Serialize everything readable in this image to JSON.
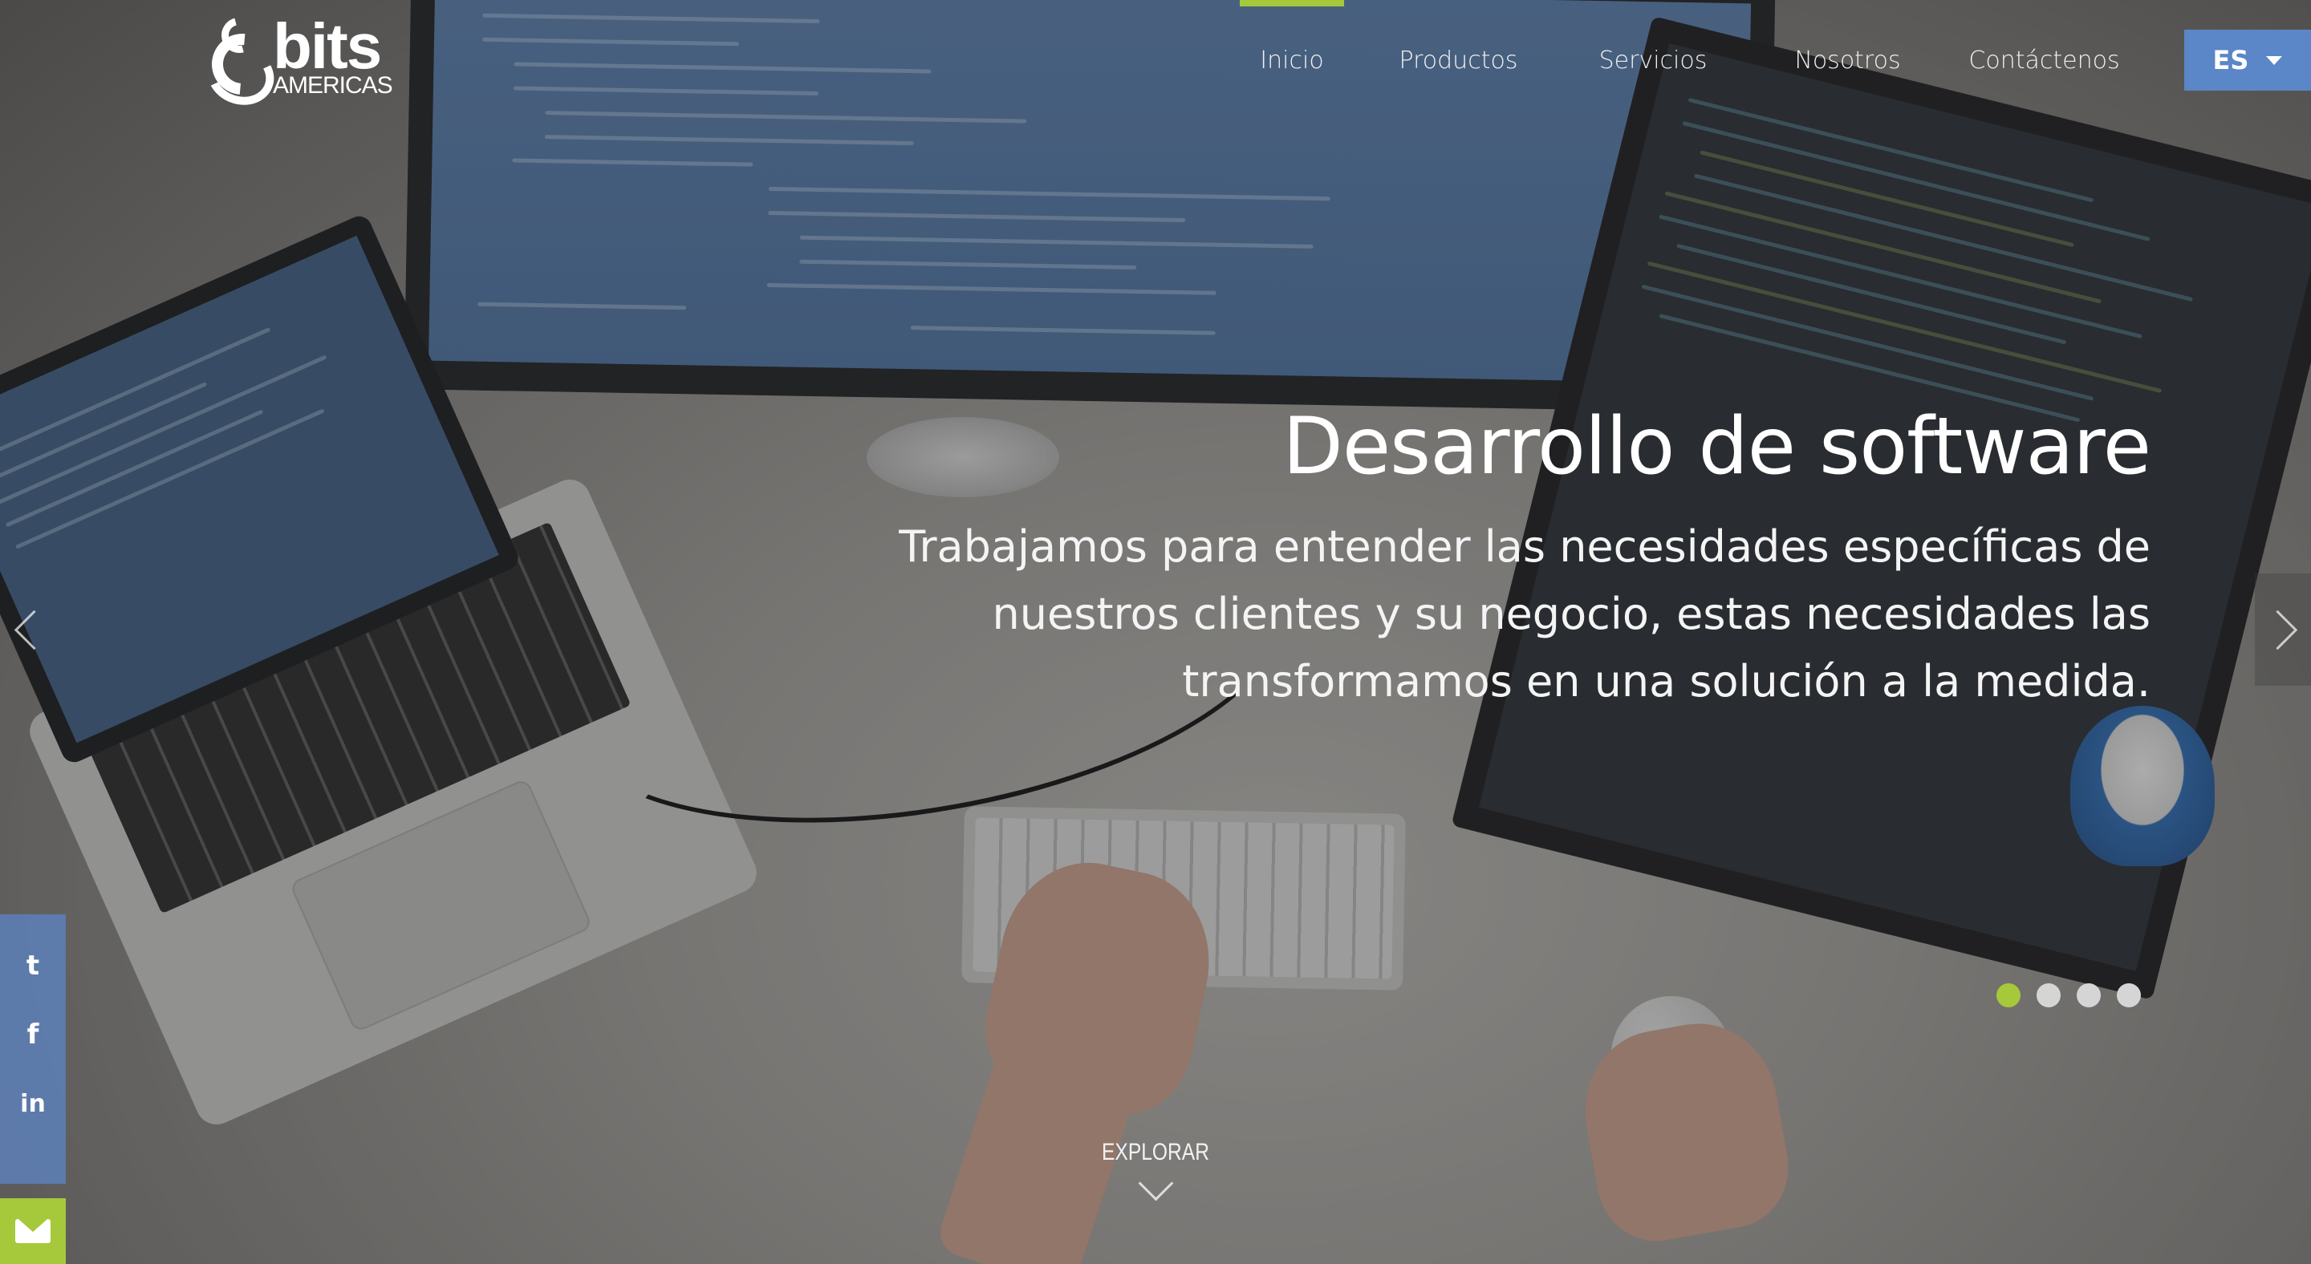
{
  "brand": {
    "name": "bits",
    "subtitle": "AMERICAS"
  },
  "nav": {
    "items": [
      {
        "label": "Inicio",
        "active": true
      },
      {
        "label": "Productos",
        "active": false
      },
      {
        "label": "Servicios",
        "active": false
      },
      {
        "label": "Nosotros",
        "active": false
      },
      {
        "label": "Contáctenos",
        "active": false
      }
    ],
    "language": "ES"
  },
  "hero": {
    "title": "Desarrollo de software",
    "description": "Trabajamos para entender las necesidades específicas de nuestros clientes y su negocio, estas necesidades las transformamos en una solución a la medida."
  },
  "carousel": {
    "slide_count": 4,
    "active_index": 0
  },
  "explore": {
    "label": "EXPLORAR"
  },
  "social": {
    "icons": [
      "twitter-icon",
      "facebook-icon",
      "linkedin-icon"
    ],
    "glyphs": [
      "t",
      "f",
      "in"
    ]
  },
  "colors": {
    "accent_green": "#a5c93a",
    "accent_blue": "#5b86c7",
    "text_white": "#ffffff"
  }
}
